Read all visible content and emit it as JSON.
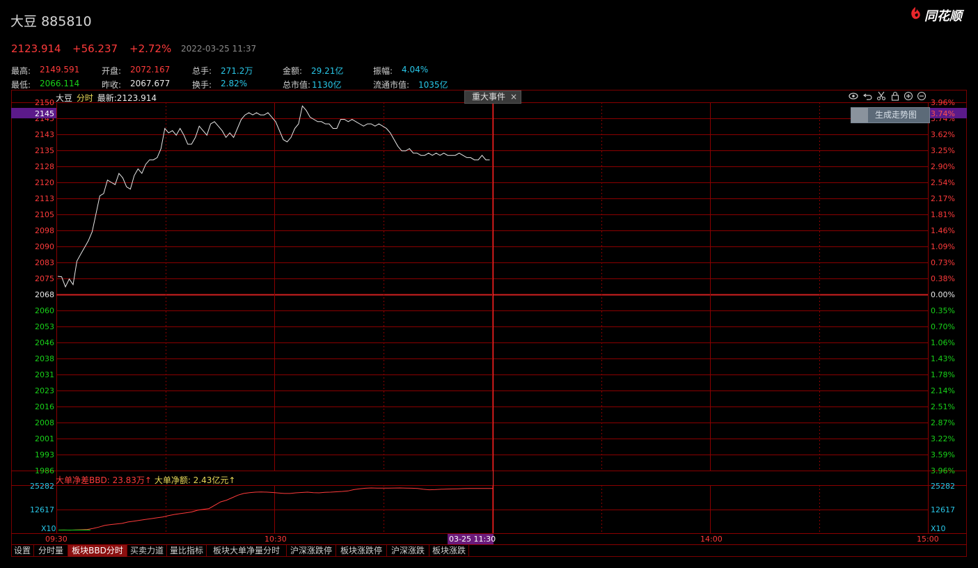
{
  "header": {
    "name": "大豆",
    "code": "885810",
    "logo_text": "同花顺"
  },
  "quote": {
    "price": "2123.914",
    "change": "+56.237",
    "change_pct": "+2.72%",
    "datetime": "2022-03-25 11:37"
  },
  "stats": [
    {
      "label": "最高:",
      "value": "2149.591",
      "color": "red"
    },
    {
      "label": "开盘:",
      "value": "2072.167",
      "color": "red"
    },
    {
      "label": "总手:",
      "value": "271.2万",
      "color": "cyan"
    },
    {
      "label": "金额:",
      "value": "29.21亿",
      "color": "cyan"
    },
    {
      "label": "振幅:",
      "value": "4.04%",
      "color": "cyan"
    },
    {
      "label": "最低:",
      "value": "2066.114",
      "color": "green"
    },
    {
      "label": "昨收:",
      "value": "2067.677",
      "color": "white"
    },
    {
      "label": "换手:",
      "value": "2.82%",
      "color": "cyan"
    },
    {
      "label": "总市值:",
      "value": "1130亿",
      "color": "cyan"
    },
    {
      "label": "流通市值:",
      "value": "1035亿",
      "color": "cyan"
    }
  ],
  "chart_info": {
    "name": "大豆",
    "mode": "分时",
    "latest_label": "最新:",
    "latest_value": "2123.914",
    "event_tab": "重大事件",
    "event_close": "×",
    "generate_button": "生成走势图",
    "cursor_price": "2145",
    "cursor_pct": "3.74%",
    "time_cursor_label": "03-25 11:30",
    "x_scale_label": "X10",
    "bbd_label": "大单净差BBD: 23.83万↑",
    "net_label": "大单净额: 2.43亿元↑"
  },
  "toolbar_icons": [
    "eye-icon",
    "undo-icon",
    "scissors-icon",
    "lock-icon",
    "zoom-in-icon",
    "zoom-out-icon"
  ],
  "tabs": [
    {
      "label": "设置",
      "active": false
    },
    {
      "label": "分时量",
      "active": false
    },
    {
      "label": "板块BBD分时",
      "active": true
    },
    {
      "label": "买卖力道",
      "active": false
    },
    {
      "label": "量比指标",
      "active": false
    },
    {
      "label": "板块大单净量分时",
      "active": false
    },
    {
      "label": "沪深涨跌停",
      "active": false
    },
    {
      "label": "板块涨跌停",
      "active": false
    },
    {
      "label": "沪深涨跌",
      "active": false
    },
    {
      "label": "板块涨跌",
      "active": false
    }
  ],
  "colors": {
    "up": "#ff3b3b",
    "down": "#19d219",
    "grid": "#8b0000",
    "line": "#e8e8e8",
    "cyan": "#29c7e8",
    "highlight": "#5b1a8a"
  },
  "chart_data": [
    {
      "type": "line",
      "title": "",
      "prev_close": 2067.677,
      "y_ticks_left": [
        "2150",
        "2145",
        "2143",
        "2135",
        "2128",
        "2120",
        "2113",
        "2105",
        "2098",
        "2090",
        "2083",
        "2075",
        "2068",
        "2060",
        "2053",
        "2046",
        "2038",
        "2031",
        "2023",
        "2016",
        "2008",
        "2001",
        "1993",
        "1986"
      ],
      "y_ticks_right": [
        "3.96%",
        "3.74%",
        "3.62%",
        "3.25%",
        "2.90%",
        "2.54%",
        "2.17%",
        "1.81%",
        "1.46%",
        "1.09%",
        "0.73%",
        "0.38%",
        "0.00%",
        "0.35%",
        "0.70%",
        "1.06%",
        "1.43%",
        "1.78%",
        "2.14%",
        "2.51%",
        "2.87%",
        "3.22%",
        "3.59%",
        "3.96%"
      ],
      "x_ticks": [
        "09:30",
        "10:30",
        "14:00",
        "15:00"
      ],
      "ylim": [
        1985.8,
        2149.6
      ],
      "x_minutes_total": 240,
      "series": [
        {
          "values": [
            2072.2,
            2072.0,
            2067.5,
            2071.0,
            2068.5,
            2079,
            2082,
            2085,
            2088,
            2092,
            2100,
            2108,
            2109,
            2115,
            2114,
            2113,
            2118,
            2116,
            2112,
            2111,
            2117,
            2120,
            2118,
            2122,
            2124,
            2124,
            2125,
            2129,
            2138,
            2136,
            2137,
            2135,
            2138,
            2135,
            2131,
            2131,
            2134,
            2139,
            2137,
            2135,
            2140,
            2141,
            2139,
            2137,
            2134,
            2136,
            2134,
            2138,
            2142,
            2144,
            2145,
            2144,
            2145,
            2144,
            2144,
            2145,
            2143,
            2141,
            2137,
            2133,
            2132,
            2134,
            2138,
            2140,
            2148,
            2146,
            2143,
            2142,
            2141,
            2141,
            2140,
            2140,
            2138,
            2138,
            2142,
            2142,
            2141,
            2142,
            2141,
            2140,
            2139,
            2140,
            2140,
            2139,
            2140,
            2139,
            2138,
            2136,
            2133,
            2130,
            2128,
            2128,
            2129,
            2127,
            2127,
            2126,
            2126,
            2127,
            2126,
            2127,
            2126,
            2127,
            2126,
            2126,
            2126,
            2127,
            2126,
            2125,
            2125,
            2124,
            2124,
            2126,
            2124,
            2124
          ]
        }
      ]
    },
    {
      "type": "line",
      "title": "大单净差BBD",
      "y_ticks": [
        "25282",
        "12617"
      ],
      "ylim": [
        0,
        25282
      ],
      "series": [
        {
          "name": "大单净差BBD",
          "values": [
            200,
            250,
            150,
            300,
            400,
            600,
            1200,
            2000,
            3000,
            3500,
            3800,
            4200,
            5000,
            5500,
            6000,
            6500,
            7000,
            7500,
            8000,
            8800,
            9500,
            10000,
            10500,
            11000,
            12000,
            12500,
            13000,
            15000,
            17000,
            18000,
            19500,
            21000,
            22000,
            22500,
            22800,
            22900,
            22800,
            22600,
            22300,
            22000,
            22000,
            22400,
            22600,
            22800,
            22500,
            22400,
            22700,
            22800,
            23000,
            23200,
            23500,
            24300,
            24800,
            25100,
            25282,
            25200,
            25150,
            25200,
            25250,
            25282,
            25200,
            25100,
            25000,
            24500,
            24200,
            24300,
            24500,
            24600,
            24700,
            24800,
            24900,
            25000,
            25000,
            25000,
            25000,
            25000
          ]
        }
      ]
    }
  ]
}
